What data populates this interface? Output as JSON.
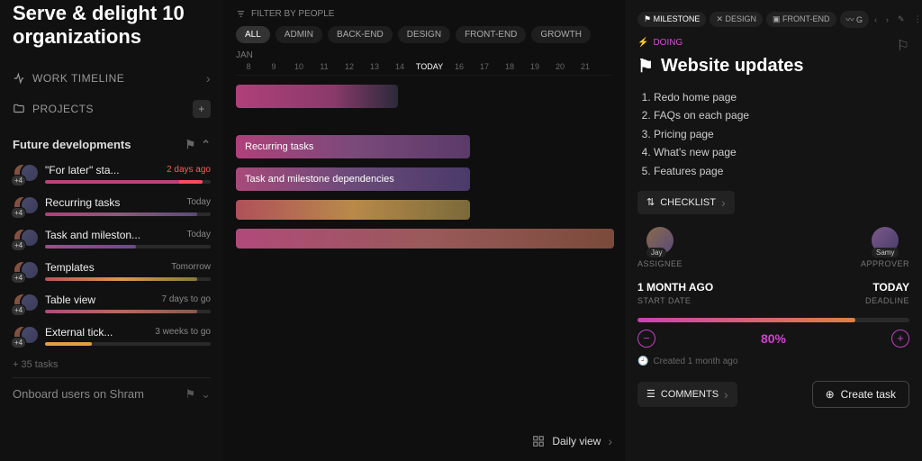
{
  "sidebar": {
    "title": "Serve & delight 10 organizations",
    "work_timeline": "WORK TIMELINE",
    "projects_label": "PROJECTS",
    "project": {
      "name": "Future developments",
      "tasks": [
        {
          "name": "\"For later\" sta...",
          "time": "2 days ago",
          "overdue": true,
          "avatar_extra": "+4",
          "bar": "linear-gradient(90deg,#c0407a 0%,#c0407a 85%,#ff4a5a 85%)",
          "width": "95%"
        },
        {
          "name": "Recurring tasks",
          "time": "Today",
          "overdue": false,
          "avatar_extra": "+4",
          "bar": "linear-gradient(90deg,#b0407a,#8a5a7a,#5a4a7a)",
          "width": "92%"
        },
        {
          "name": "Task and mileston...",
          "time": "Today",
          "overdue": false,
          "avatar_extra": "+4",
          "bar": "linear-gradient(90deg,#a84a8a,#6a4a8a)",
          "width": "55%"
        },
        {
          "name": "Templates",
          "time": "Tomorrow",
          "overdue": false,
          "avatar_extra": "+4",
          "bar": "linear-gradient(90deg,#c0505a,#d89a4a,#8a7a3a)",
          "width": "92%"
        },
        {
          "name": "Table view",
          "time": "7 days to go",
          "overdue": false,
          "avatar_extra": "+4",
          "bar": "linear-gradient(90deg,#b04a7a,#b86a5a,#8a5a4a)",
          "width": "92%"
        },
        {
          "name": "External tick...",
          "time": "3 weeks to go",
          "overdue": false,
          "avatar_extra": "+4",
          "bar": "linear-gradient(90deg,#e0a040,#e0a040)",
          "width": "28%"
        }
      ],
      "more": "+ 35 tasks"
    },
    "collapsed_project": "Onboard users on Shram"
  },
  "timeline": {
    "filter_label": "FILTER BY PEOPLE",
    "chips": [
      "ALL",
      "ADMIN",
      "BACK-END",
      "DESIGN",
      "FRONT-END",
      "GROWTH"
    ],
    "month": "JAN",
    "dates": [
      "8",
      "9",
      "10",
      "11",
      "12",
      "13",
      "14",
      "TODAY",
      "16",
      "17",
      "18",
      "19",
      "20",
      "21"
    ],
    "today_index": 7,
    "bars": [
      {
        "label": ""
      },
      {
        "label": "Recurring tasks"
      },
      {
        "label": "Task and milestone dependencies"
      },
      {
        "label": ""
      },
      {
        "label": ""
      }
    ],
    "view_label": "Daily view"
  },
  "detail": {
    "tags": [
      "MILESTONE",
      "DESIGN",
      "FRONT-END",
      "G"
    ],
    "status": "DOING",
    "title": "Website updates",
    "items": [
      "Redo home page",
      "FAQs on each page",
      "Pricing page",
      "What's new page",
      "Features page"
    ],
    "checklist_btn": "CHECKLIST",
    "assignee": {
      "name": "Jay",
      "role": "ASSIGNEE"
    },
    "approver": {
      "name": "Samy",
      "role": "APPROVER"
    },
    "start": {
      "value": "1 MONTH AGO",
      "label": "START DATE"
    },
    "deadline": {
      "value": "TODAY",
      "label": "DEADLINE"
    },
    "progress_pct": "80%",
    "created": "Created 1 month ago",
    "comments_btn": "COMMENTS",
    "create_btn": "Create task"
  }
}
